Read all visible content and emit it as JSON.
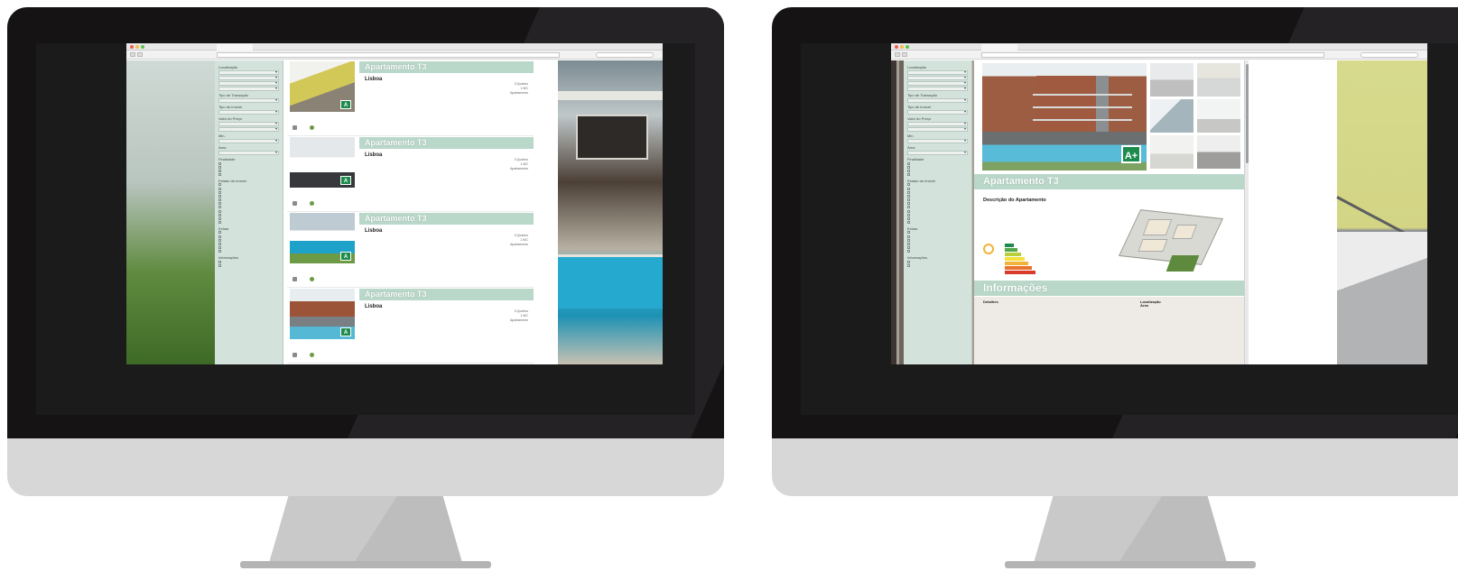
{
  "left_screen": {
    "browser": {
      "tab_title": "",
      "url": "",
      "search_placeholder": ""
    },
    "sidebar": {
      "groups": [
        {
          "title": "Localização",
          "selects": [
            "",
            "",
            "",
            ""
          ]
        },
        {
          "title": "Tipo de Transação",
          "selects": [
            ""
          ]
        },
        {
          "title": "Tipo de Imóvel",
          "selects": [
            ""
          ]
        },
        {
          "title": "Valor do Preço",
          "selects": [
            "",
            ""
          ]
        },
        {
          "title": "Min.",
          "selects": [
            ""
          ]
        },
        {
          "title": "Área",
          "selects": [
            ""
          ]
        }
      ],
      "check_sections": [
        {
          "title": "Finalidade",
          "items": [
            "",
            "",
            "",
            ""
          ]
        },
        {
          "title": "Estado do Imóvel",
          "items": [
            "",
            "",
            "",
            "",
            "",
            "",
            "",
            "",
            "",
            "",
            ""
          ]
        },
        {
          "title": "Extras",
          "items": [
            "",
            "",
            "",
            "",
            "",
            ""
          ]
        },
        {
          "title": "Informações",
          "items": [
            "",
            ""
          ]
        }
      ]
    },
    "listings": [
      {
        "title": "Apartamento T3",
        "city": "Lisboa",
        "area": "",
        "price": "",
        "specs": [
          "3 Quartos",
          "1 WC",
          "Apartamento",
          ""
        ],
        "ref": "",
        "badge": "A",
        "action_1": "",
        "action_2": ""
      },
      {
        "title": "Apartamento T3",
        "city": "Lisboa",
        "area": "",
        "price": "",
        "specs": [
          "3 Quartos",
          "1 WC",
          "Apartamento",
          ""
        ],
        "ref": "",
        "badge": "A",
        "action_1": "",
        "action_2": ""
      },
      {
        "title": "Apartamento T3",
        "city": "Lisboa",
        "area": "",
        "price": "",
        "specs": [
          "3 Quartos",
          "1 WC",
          "Apartamento",
          ""
        ],
        "ref": "",
        "badge": "A",
        "action_1": "",
        "action_2": ""
      },
      {
        "title": "Apartamento T3",
        "city": "Lisboa",
        "area": "",
        "price": "",
        "specs": [
          "3 Quartos",
          "1 WC",
          "Apartamento",
          ""
        ],
        "ref": "",
        "badge": "A",
        "action_1": "",
        "action_2": ""
      }
    ]
  },
  "right_screen": {
    "browser": {
      "tab_title": "",
      "url": "",
      "search_placeholder": ""
    },
    "detail": {
      "main_badge": "A+",
      "title": "Apartamento T3",
      "description_title": "Descrição do Apartamento",
      "description_text": "",
      "certificate_label": "",
      "info_section_title": "Informações",
      "info_left_head": "Detalhes",
      "info_left_rows": [
        {
          "k": "",
          "v": ""
        },
        {
          "k": "",
          "v": ""
        },
        {
          "k": "",
          "v": ""
        },
        {
          "k": "",
          "v": ""
        },
        {
          "k": "",
          "v": ""
        },
        {
          "k": "",
          "v": ""
        },
        {
          "k": "",
          "v": ""
        }
      ],
      "info_right_head": "Localização",
      "info_right_rows": [
        {
          "k": "",
          "v": ""
        },
        {
          "k": "",
          "v": ""
        },
        {
          "k": "",
          "v": ""
        }
      ],
      "info_right_head_2": "Área",
      "info_right_rows_2": [
        {
          "k": "",
          "v": ""
        },
        {
          "k": "",
          "v": ""
        }
      ]
    }
  },
  "colors": {
    "accent_bar": "#b9d8ca",
    "sidebar_bg": "#d4e2dc",
    "energy_badge": "#1c8b4b",
    "monitor_bezel": "#151314",
    "monitor_chin": "#d6d7d6"
  },
  "energy_scale_colors": [
    "#1c8b4b",
    "#55a84a",
    "#b6cf3b",
    "#f4e13a",
    "#f3b23a",
    "#e8742f",
    "#d83a2b"
  ]
}
